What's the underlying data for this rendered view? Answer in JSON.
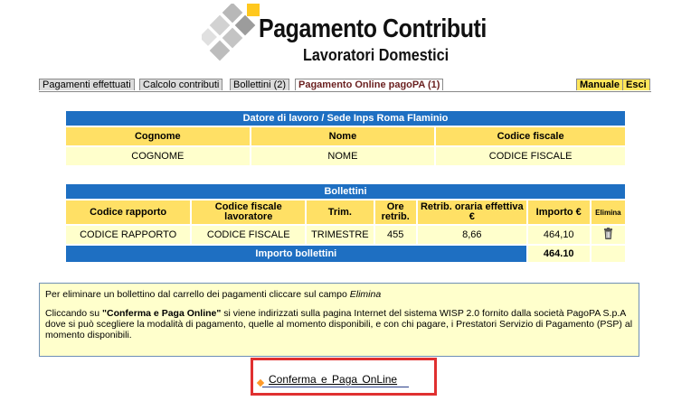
{
  "header": {
    "title": "Pagamento Contributi",
    "subtitle": "Lavoratori Domestici"
  },
  "tabs": {
    "left": [
      "Pagamenti effettuati",
      "Calcolo contributi",
      "Bollettini (2)",
      "Pagamento Online pagoPA (1)"
    ],
    "right": [
      "Manuale",
      "Esci"
    ]
  },
  "employer_table": {
    "title": "Datore di lavoro / Sede Inps Roma Flaminio",
    "columns": [
      "Cognome",
      "Nome",
      "Codice fiscale"
    ],
    "row": [
      "COGNOME",
      "NOME",
      "CODICE FISCALE"
    ]
  },
  "bollettini_table": {
    "title": "Bollettini",
    "columns": [
      "Codice rapporto",
      "Codice fiscale lavoratore",
      "Trim.",
      "Ore retrib.",
      "Retrib. oraria effettiva €",
      "Importo €",
      "Elimina"
    ],
    "row": [
      "CODICE RAPPORTO",
      "CODICE FISCALE",
      "TRIMESTRE",
      "455",
      "8,66",
      "464,10"
    ],
    "total_label": "Importo bollettini",
    "total_value": "464.10"
  },
  "info": {
    "line1_prefix": "Per eliminare un bollettino dal carrello dei pagamenti cliccare sul campo ",
    "line1_em": "Elimina",
    "line2_prefix": "Cliccando su ",
    "line2_bold": "\"Conferma e Paga Online\"",
    "line2_rest": " si viene indirizzati sulla pagina Internet del sistema WISP 2.0 fornito dalla società PagoPA S.p.A dove si può scegliere la modalità di pagamento, quelle al momento disponibili, e con chi pagare, i Prestatori Servizio di Pagamento (PSP) al momento disponibili."
  },
  "confirm": {
    "label": "Conferma e Paga OnLine"
  },
  "colors": {
    "header_blue": "#1e6fc2",
    "column_yellow": "#ffe065",
    "cell_cream": "#ffffcc",
    "highlight_red": "#e03030"
  }
}
